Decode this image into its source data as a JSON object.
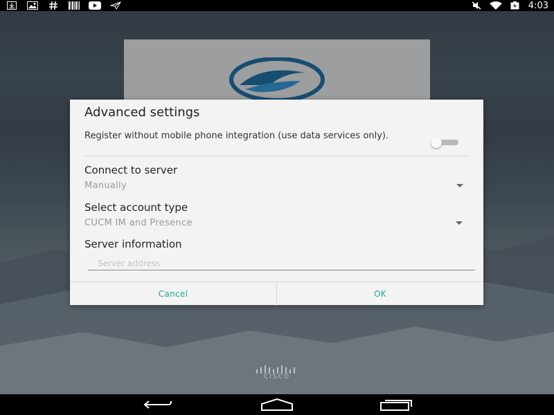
{
  "status_bar": {
    "left_icons": [
      "download-icon",
      "gallery-icon",
      "hashtag-icon",
      "barcode-icon",
      "youtube-icon",
      "airplane-doc-icon"
    ],
    "right_icons": [
      "mute-icon",
      "wifi-icon",
      "battery-icon"
    ],
    "time": "4:03"
  },
  "dialog": {
    "title": "Advanced settings",
    "mobile_integration": {
      "label": "Register without mobile phone integration (use data services only).",
      "enabled": false
    },
    "connect_to_server": {
      "label": "Connect to server",
      "value": "Manually"
    },
    "account_type": {
      "label": "Select account type",
      "value": "CUCM IM and Presence"
    },
    "server_information": {
      "label": "Server information",
      "placeholder": "Server address",
      "value": ""
    },
    "cancel_label": "Cancel",
    "ok_label": "OK"
  },
  "footer": {
    "brand": "CISCO"
  },
  "nav_bar": {
    "icons": [
      "back-icon",
      "home-icon",
      "recents-icon"
    ]
  },
  "colors": {
    "accent": "#26a69a",
    "dialog_bg": "#f3f3f3",
    "status_bar": "#000000"
  }
}
